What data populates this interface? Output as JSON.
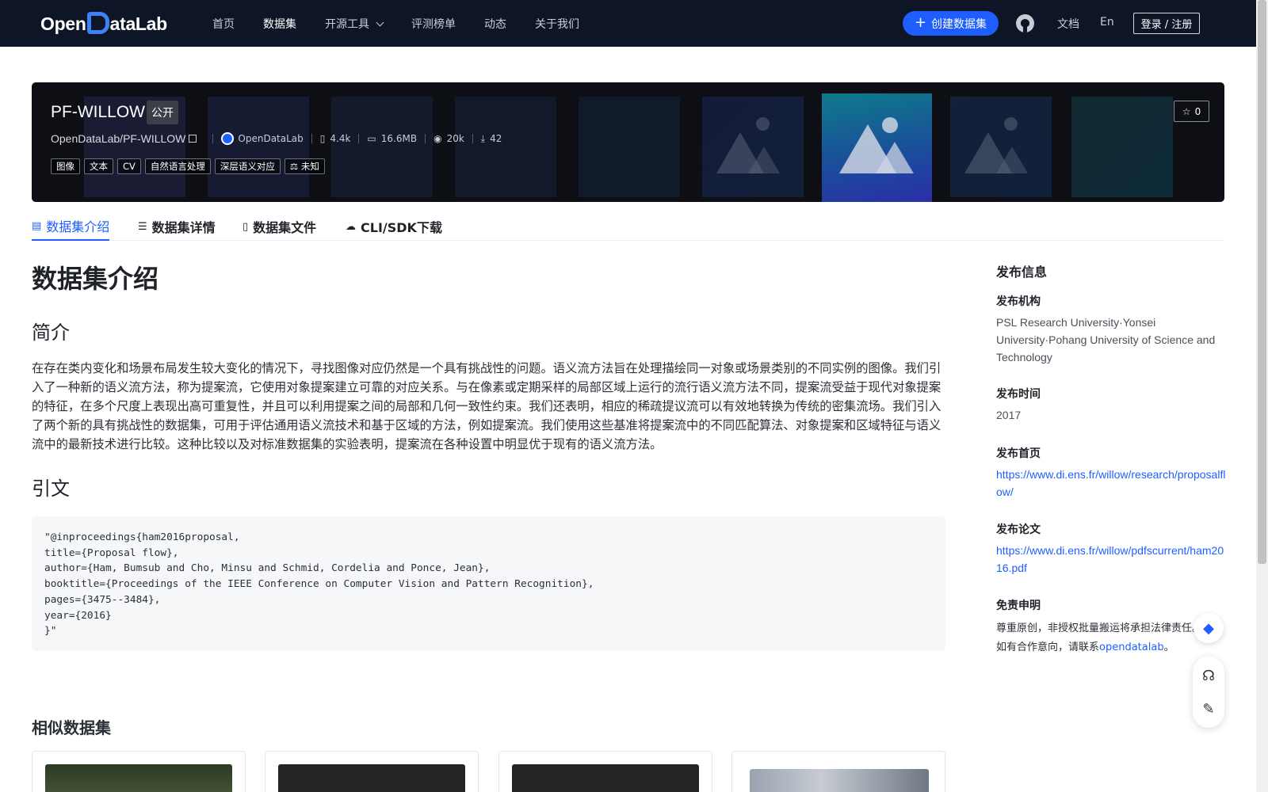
{
  "nav": {
    "logo_text_left": "Open",
    "logo_text_right": "ataLab",
    "links": [
      {
        "label": "首页"
      },
      {
        "label": "数据集"
      },
      {
        "label": "开源工具"
      },
      {
        "label": "评测榜单"
      },
      {
        "label": "动态"
      },
      {
        "label": "关于我们"
      }
    ],
    "create_label": "创建数据集",
    "docs_label": "文档",
    "lang_label": "En",
    "login_label": "登录 / 注册"
  },
  "dataset": {
    "title": "PF-WILLOW",
    "visibility": "公开",
    "path": "OpenDataLab/PF-WILLOW",
    "org": "OpenDataLab",
    "likes": "4.4k",
    "size": "16.6MB",
    "views": "20k",
    "downloads": "42",
    "star_count": "0",
    "tags": [
      "图像",
      "文本",
      "CV",
      "自然语言处理",
      "深层语义对应",
      "未知"
    ]
  },
  "tabs": [
    {
      "label": "数据集介绍",
      "icon": "database-icon"
    },
    {
      "label": "数据集详情",
      "icon": "list-icon"
    },
    {
      "label": "数据集文件",
      "icon": "file-icon"
    },
    {
      "label": "CLI/SDK下载",
      "icon": "cloud-download-icon"
    }
  ],
  "main": {
    "heading": "数据集介绍",
    "intro_heading": "简介",
    "intro_text": "在存在类内变化和场景布局发生较大变化的情况下，寻找图像对应仍然是一个具有挑战性的问题。语义流方法旨在处理描绘同一对象或场景类别的不同实例的图像。我们引入了一种新的语义流方法，称为提案流，它使用对象提案建立可靠的对应关系。与在像素或定期采样的局部区域上运行的流行语义流方法不同，提案流受益于现代对象提案的特征，在多个尺度上表现出高可重复性，并且可以利用提案之间的局部和几何一致性约束。我们还表明，相应的稀疏提议流可以有效地转换为传统的密集流场。我们引入了两个新的具有挑战性的数据集，可用于评估通用语义流技术和基于区域的方法，例如提案流。我们使用这些基准将提案流中的不同匹配算法、对象提案和区域特征与语义流中的最新技术进行比较。这种比较以及对标准数据集的实验表明，提案流在各种设置中明显优于现有的语义流方法。",
    "citation_heading": "引文",
    "citation": "\"@inproceedings{ham2016proposal,\ntitle={Proposal flow},\nauthor={Ham, Bumsub and Cho, Minsu and Schmid, Cordelia and Ponce, Jean},\nbooktitle={Proceedings of the IEEE Conference on Computer Vision and Pattern Recognition},\npages={3475--3484},\nyear={2016}\n}\"",
    "similar_heading": "相似数据集"
  },
  "sidebar": {
    "title": "发布信息",
    "org_label": "发布机构",
    "org_value": "PSL Research University·Yonsei University·Pohang University of Science and Technology",
    "time_label": "发布时间",
    "time_value": "2017",
    "homepage_label": "发布首页",
    "homepage_value": "https://www.di.ens.fr/willow/research/proposalflow/",
    "paper_label": "发布论文",
    "paper_value": "https://www.di.ens.fr/willow/pdfscurrent/ham2016.pdf",
    "disclaimer_label": "免责申明",
    "disclaimer_text": "尊重原创，非授权批量搬运将承担法律责任。如有合作意向，请联系",
    "disclaimer_link": "opendatalab",
    "disclaimer_end": "。"
  },
  "colors": {
    "nav_bg": "#0d1526",
    "accent": "#1e5eff",
    "banner_bg": "#0d0f14"
  }
}
